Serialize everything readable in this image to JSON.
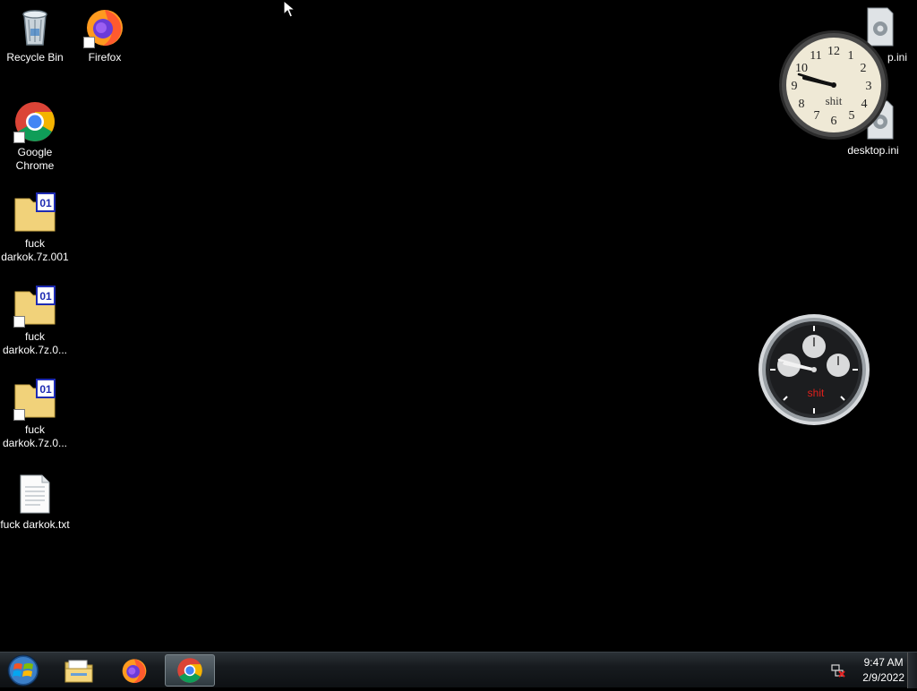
{
  "desktop": {
    "icons": [
      {
        "label": "Recycle Bin",
        "icon": "recycle-bin-icon"
      },
      {
        "label": "Firefox",
        "icon": "firefox-icon"
      },
      {
        "label": "Google Chrome",
        "icon": "chrome-icon"
      },
      {
        "label": "fuck darkok.7z.001",
        "icon": "archive-file-icon"
      },
      {
        "label": "fuck darkok.7z.0...",
        "icon": "archive-file-icon"
      },
      {
        "label": "fuck darkok.7z.0...",
        "icon": "archive-file-icon"
      },
      {
        "label": "fuck darkok.txt",
        "icon": "text-file-icon"
      },
      {
        "label": "desktop.ini",
        "icon": "settings-file-icon"
      },
      {
        "label": "desktop.ini",
        "icon": "settings-file-icon"
      }
    ],
    "partial_label": "p.ini"
  },
  "gadgets": {
    "analog_clock": {
      "label": "shit",
      "time": "9:47"
    },
    "chrono_clock": {
      "label": "shit"
    }
  },
  "taskbar": {
    "items": [
      {
        "name": "Windows Explorer",
        "icon": "folder-icon"
      },
      {
        "name": "Firefox",
        "icon": "firefox-icon"
      },
      {
        "name": "Google Chrome",
        "icon": "chrome-icon",
        "active": true
      }
    ],
    "clock": {
      "time": "9:47 AM",
      "date": "2/9/2022"
    }
  },
  "colors": {
    "desktop_bg": "#000000",
    "taskbar_bg": "#171b1f",
    "chrono_label": "#e0201c"
  }
}
